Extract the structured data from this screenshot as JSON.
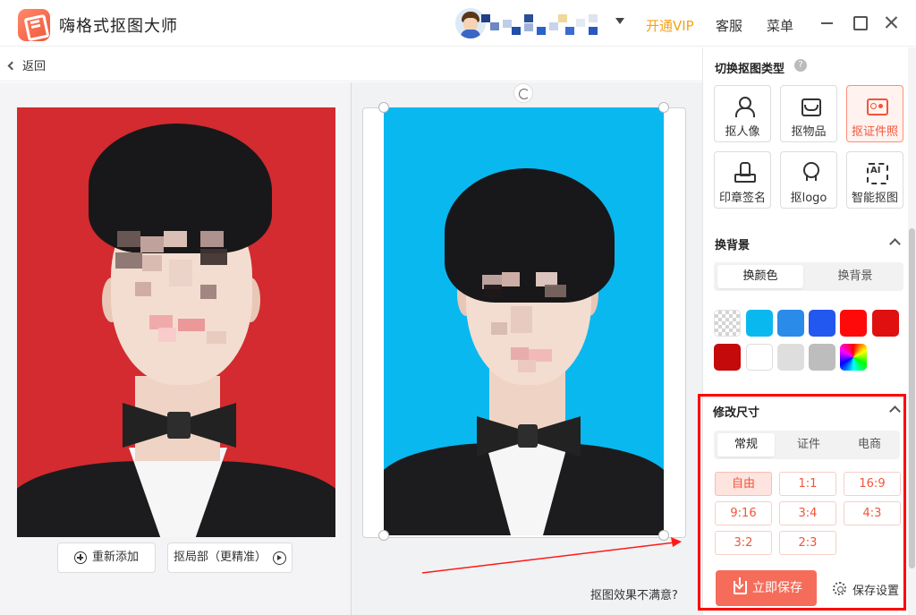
{
  "app": {
    "title": "嗨格式抠图大师"
  },
  "header": {
    "vip_label": "开通VIP",
    "service_label": "客服",
    "menu_label": "菜单"
  },
  "toolbar": {
    "back_label": "返回"
  },
  "left_pane": {
    "original_bg": "#d32b2f",
    "readd_label": "重新添加",
    "refine_label": "抠局部（更精准）"
  },
  "preview": {
    "bg": "#0ab8f0",
    "unsatisfied_label": "抠图效果不满意?"
  },
  "panel": {
    "type_section": {
      "title": "切换抠图类型",
      "types": [
        {
          "label": "抠人像",
          "icon": "person-icon",
          "active": false
        },
        {
          "label": "抠物品",
          "icon": "box-icon",
          "active": false
        },
        {
          "label": "抠证件照",
          "icon": "id-card-icon",
          "active": true
        },
        {
          "label": "印章签名",
          "icon": "stamp-icon",
          "active": false
        },
        {
          "label": "抠logo",
          "icon": "award-icon",
          "active": false
        },
        {
          "label": "智能抠图",
          "icon": "ai-icon",
          "active": false
        }
      ]
    },
    "background_section": {
      "title": "换背景",
      "tabs": [
        {
          "label": "换颜色",
          "active": true
        },
        {
          "label": "换背景",
          "active": false
        }
      ],
      "colors": [
        "transparent",
        "#0ab8f0",
        "#2a8be8",
        "#2258f0",
        "#ff0a0a",
        "#e01010",
        "#c40a0a",
        "#ffffff",
        "#dedede",
        "#bdbdbd",
        "rainbow"
      ]
    },
    "size_section": {
      "title": "修改尺寸",
      "tabs": [
        {
          "label": "常规",
          "active": true
        },
        {
          "label": "证件",
          "active": false
        },
        {
          "label": "电商",
          "active": false
        }
      ],
      "ratios": [
        {
          "label": "自由",
          "active": true
        },
        {
          "label": "1:1",
          "active": false
        },
        {
          "label": "16:9",
          "active": false
        },
        {
          "label": "9:16",
          "active": false
        },
        {
          "label": "3:4",
          "active": false
        },
        {
          "label": "4:3",
          "active": false
        },
        {
          "label": "3:2",
          "active": false
        },
        {
          "label": "2:3",
          "active": false
        }
      ]
    },
    "save_label": "立即保存",
    "settings_label": "保存设置"
  }
}
